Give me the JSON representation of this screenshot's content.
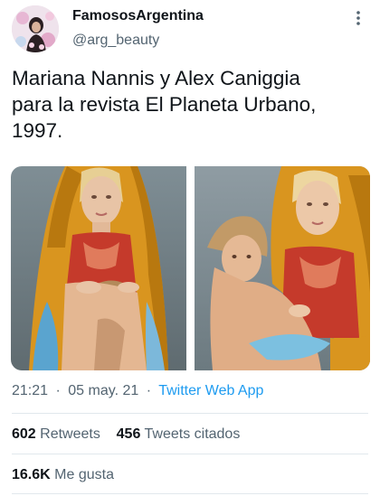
{
  "tweet": {
    "author": {
      "display_name": "FamososArgentina",
      "handle": "@arg_beauty",
      "avatar_icon": "avatar-photo"
    },
    "text": "Mariana Nannis y Alex Caniggia\npara la revista El Planeta Urbano,\n1997.",
    "timestamp": {
      "time": "21:21",
      "date": "05 may. 21",
      "separator": "·",
      "source": "Twitter Web App"
    },
    "stats": {
      "retweets_count": "602",
      "retweets_label": "Retweets",
      "quotes_count": "456",
      "quotes_label": "Tweets citados",
      "likes_count": "16.6K",
      "likes_label": "Me gusta"
    },
    "more_icon": "more-vertical-icon"
  },
  "colors": {
    "text_primary": "#0f1419",
    "text_secondary": "#536471",
    "link": "#1d9bf0",
    "divider": "#e1e8ed"
  }
}
